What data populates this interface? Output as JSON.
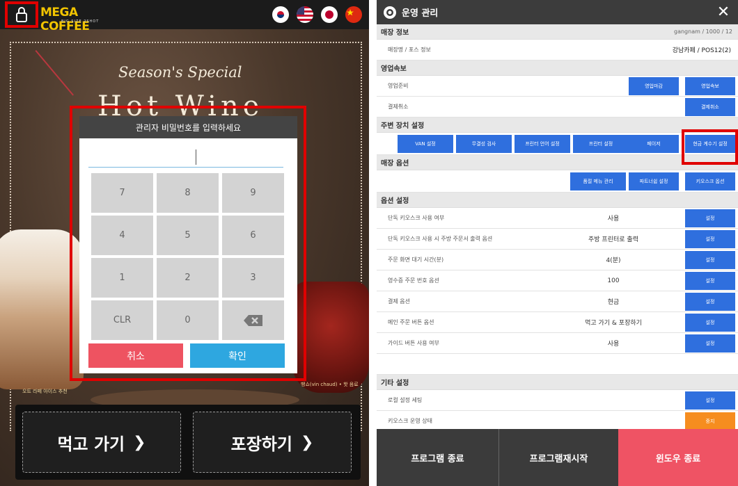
{
  "kiosk": {
    "logo_text": "MEGA COFFEE",
    "logo_sub": "BIG SIZE 2SHOT",
    "promo_title": "Season's Special",
    "promo_big": "Hot Wine",
    "flags": [
      "korea-flag-icon",
      "us-flag-icon",
      "japan-flag-icon",
      "china-flag-icon"
    ],
    "tag_left": "오트 라떼 아이스 추천",
    "tag_right": "뱅쇼(vin chaud) • 핫 음료",
    "buttons": {
      "eat_in": "먹고 가기",
      "takeout": "포장하기",
      "chevron": "❯"
    }
  },
  "password_dialog": {
    "title": "관리자 비밀번호를 입력하세요",
    "input_value": "",
    "keys": [
      "7",
      "8",
      "9",
      "4",
      "5",
      "6",
      "1",
      "2",
      "3",
      "CLR",
      "0",
      "⌫"
    ],
    "cancel_label": "취소",
    "confirm_label": "확인"
  },
  "admin": {
    "title": "운영 관리",
    "close_label": "✕",
    "store_info": {
      "header": "매장 정보",
      "store_meta": "gangnam / 1000 / 12",
      "row_label": "매장명 / 포스 정보",
      "row_value": "강남카페 / POS12(2)"
    },
    "business": {
      "header": "영업속보",
      "rows": [
        {
          "label": "영업준비",
          "buttons": [
            "영업마감",
            "영업속보"
          ]
        },
        {
          "label": "결제취소",
          "buttons": [
            "결제취소"
          ]
        }
      ]
    },
    "devices": {
      "header": "주변 장치 설정",
      "buttons": [
        "VAN 설정",
        "무결성 검사",
        "프린터 언어 설정",
        "프린터 설정",
        "페이저",
        "현금 계수기 설정"
      ]
    },
    "store_options": {
      "header": "매장 옵션",
      "buttons": [
        "품절 메뉴 관리",
        "파트너쉽 설정",
        "키오스크 옵션"
      ]
    },
    "option_settings": {
      "header": "옵션 설정",
      "button_label": "설정",
      "rows": [
        {
          "label": "단독 키오스크 사용 여부",
          "value": "사용"
        },
        {
          "label": "단독 키오스크 사용 시 주방 주문서 출력 옵션",
          "value": "주방 프린터로 출력"
        },
        {
          "label": "주문 화면 대기 시간(분)",
          "value": "4(분)"
        },
        {
          "label": "영수증 주문 번호 옵션",
          "value": "100"
        },
        {
          "label": "결제 옵션",
          "value": "현금"
        },
        {
          "label": "메인 주문 버튼 옵션",
          "value": "먹고 가기 & 포장하기"
        },
        {
          "label": "가이드 버튼 사용 여부",
          "value": "사용"
        }
      ]
    },
    "other": {
      "header": "기타 설정",
      "rows": [
        {
          "label": "로컬 설정 세팅",
          "button": "설정"
        },
        {
          "label": "키오스크 운영 상태",
          "button": "중지"
        }
      ]
    },
    "footer": {
      "exit": "프로그램 종료",
      "restart": "프로그램재시작",
      "windows": "윈도우 종료"
    },
    "colors": {
      "blue_button": "#2f6fde",
      "orange_button": "#f68d1f",
      "highlight": "#e00000",
      "windows_exit": "#ef5364"
    }
  }
}
